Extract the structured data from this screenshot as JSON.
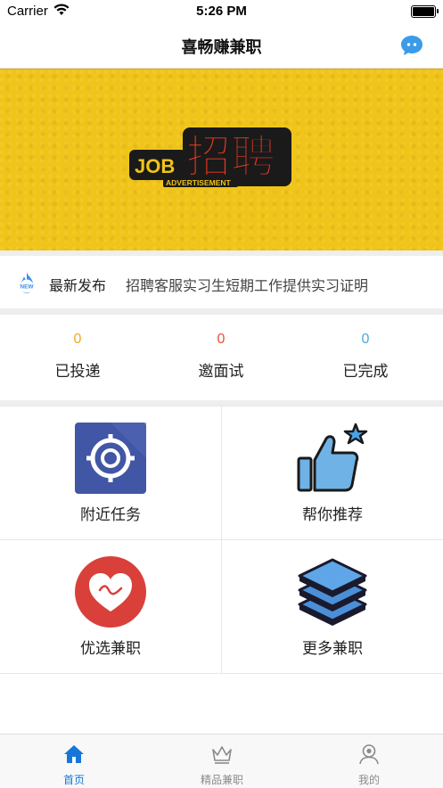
{
  "status_bar": {
    "carrier": "Carrier",
    "time": "5:26 PM"
  },
  "nav": {
    "title": "喜畅赚兼职"
  },
  "banner": {
    "logo_word": "JOB",
    "logo_main": "招聘",
    "logo_sub": "ADVERTISEMENT"
  },
  "news": {
    "label": "最新发布",
    "badge": "NEW",
    "text": "招聘客服实习生短期工作提供实习证明"
  },
  "stats": [
    {
      "value": "0",
      "label": "已投递",
      "color": "#f5a623"
    },
    {
      "value": "0",
      "label": "邀面试",
      "color": "#e94e3c"
    },
    {
      "value": "0",
      "label": "已完成",
      "color": "#4aa8e0"
    }
  ],
  "grid": [
    {
      "label": "附近任务",
      "icon": "target-icon"
    },
    {
      "label": "帮你推荐",
      "icon": "thumbs-up-icon"
    },
    {
      "label": "优选兼职",
      "icon": "heart-icon"
    },
    {
      "label": "更多兼职",
      "icon": "layers-icon"
    }
  ],
  "tabs": [
    {
      "label": "首页",
      "icon": "home-icon",
      "active": true
    },
    {
      "label": "精品兼职",
      "icon": "crown-icon",
      "active": false
    },
    {
      "label": "我的",
      "icon": "user-icon",
      "active": false
    }
  ],
  "colors": {
    "accent": "#1677d9",
    "banner": "#f0c418",
    "tab_inactive": "#8a8a8a"
  }
}
